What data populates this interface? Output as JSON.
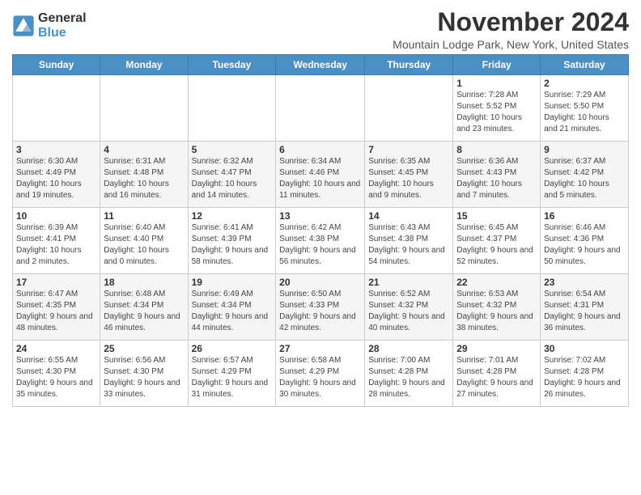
{
  "logo": {
    "general": "General",
    "blue": "Blue"
  },
  "title": "November 2024",
  "location": "Mountain Lodge Park, New York, United States",
  "days_header": [
    "Sunday",
    "Monday",
    "Tuesday",
    "Wednesday",
    "Thursday",
    "Friday",
    "Saturday"
  ],
  "weeks": [
    [
      {
        "day": "",
        "info": ""
      },
      {
        "day": "",
        "info": ""
      },
      {
        "day": "",
        "info": ""
      },
      {
        "day": "",
        "info": ""
      },
      {
        "day": "",
        "info": ""
      },
      {
        "day": "1",
        "info": "Sunrise: 7:28 AM\nSunset: 5:52 PM\nDaylight: 10 hours and 23 minutes."
      },
      {
        "day": "2",
        "info": "Sunrise: 7:29 AM\nSunset: 5:50 PM\nDaylight: 10 hours and 21 minutes."
      }
    ],
    [
      {
        "day": "3",
        "info": "Sunrise: 6:30 AM\nSunset: 4:49 PM\nDaylight: 10 hours and 19 minutes."
      },
      {
        "day": "4",
        "info": "Sunrise: 6:31 AM\nSunset: 4:48 PM\nDaylight: 10 hours and 16 minutes."
      },
      {
        "day": "5",
        "info": "Sunrise: 6:32 AM\nSunset: 4:47 PM\nDaylight: 10 hours and 14 minutes."
      },
      {
        "day": "6",
        "info": "Sunrise: 6:34 AM\nSunset: 4:46 PM\nDaylight: 10 hours and 11 minutes."
      },
      {
        "day": "7",
        "info": "Sunrise: 6:35 AM\nSunset: 4:45 PM\nDaylight: 10 hours and 9 minutes."
      },
      {
        "day": "8",
        "info": "Sunrise: 6:36 AM\nSunset: 4:43 PM\nDaylight: 10 hours and 7 minutes."
      },
      {
        "day": "9",
        "info": "Sunrise: 6:37 AM\nSunset: 4:42 PM\nDaylight: 10 hours and 5 minutes."
      }
    ],
    [
      {
        "day": "10",
        "info": "Sunrise: 6:39 AM\nSunset: 4:41 PM\nDaylight: 10 hours and 2 minutes."
      },
      {
        "day": "11",
        "info": "Sunrise: 6:40 AM\nSunset: 4:40 PM\nDaylight: 10 hours and 0 minutes."
      },
      {
        "day": "12",
        "info": "Sunrise: 6:41 AM\nSunset: 4:39 PM\nDaylight: 9 hours and 58 minutes."
      },
      {
        "day": "13",
        "info": "Sunrise: 6:42 AM\nSunset: 4:38 PM\nDaylight: 9 hours and 56 minutes."
      },
      {
        "day": "14",
        "info": "Sunrise: 6:43 AM\nSunset: 4:38 PM\nDaylight: 9 hours and 54 minutes."
      },
      {
        "day": "15",
        "info": "Sunrise: 6:45 AM\nSunset: 4:37 PM\nDaylight: 9 hours and 52 minutes."
      },
      {
        "day": "16",
        "info": "Sunrise: 6:46 AM\nSunset: 4:36 PM\nDaylight: 9 hours and 50 minutes."
      }
    ],
    [
      {
        "day": "17",
        "info": "Sunrise: 6:47 AM\nSunset: 4:35 PM\nDaylight: 9 hours and 48 minutes."
      },
      {
        "day": "18",
        "info": "Sunrise: 6:48 AM\nSunset: 4:34 PM\nDaylight: 9 hours and 46 minutes."
      },
      {
        "day": "19",
        "info": "Sunrise: 6:49 AM\nSunset: 4:34 PM\nDaylight: 9 hours and 44 minutes."
      },
      {
        "day": "20",
        "info": "Sunrise: 6:50 AM\nSunset: 4:33 PM\nDaylight: 9 hours and 42 minutes."
      },
      {
        "day": "21",
        "info": "Sunrise: 6:52 AM\nSunset: 4:32 PM\nDaylight: 9 hours and 40 minutes."
      },
      {
        "day": "22",
        "info": "Sunrise: 6:53 AM\nSunset: 4:32 PM\nDaylight: 9 hours and 38 minutes."
      },
      {
        "day": "23",
        "info": "Sunrise: 6:54 AM\nSunset: 4:31 PM\nDaylight: 9 hours and 36 minutes."
      }
    ],
    [
      {
        "day": "24",
        "info": "Sunrise: 6:55 AM\nSunset: 4:30 PM\nDaylight: 9 hours and 35 minutes."
      },
      {
        "day": "25",
        "info": "Sunrise: 6:56 AM\nSunset: 4:30 PM\nDaylight: 9 hours and 33 minutes."
      },
      {
        "day": "26",
        "info": "Sunrise: 6:57 AM\nSunset: 4:29 PM\nDaylight: 9 hours and 31 minutes."
      },
      {
        "day": "27",
        "info": "Sunrise: 6:58 AM\nSunset: 4:29 PM\nDaylight: 9 hours and 30 minutes."
      },
      {
        "day": "28",
        "info": "Sunrise: 7:00 AM\nSunset: 4:28 PM\nDaylight: 9 hours and 28 minutes."
      },
      {
        "day": "29",
        "info": "Sunrise: 7:01 AM\nSunset: 4:28 PM\nDaylight: 9 hours and 27 minutes."
      },
      {
        "day": "30",
        "info": "Sunrise: 7:02 AM\nSunset: 4:28 PM\nDaylight: 9 hours and 26 minutes."
      }
    ]
  ]
}
